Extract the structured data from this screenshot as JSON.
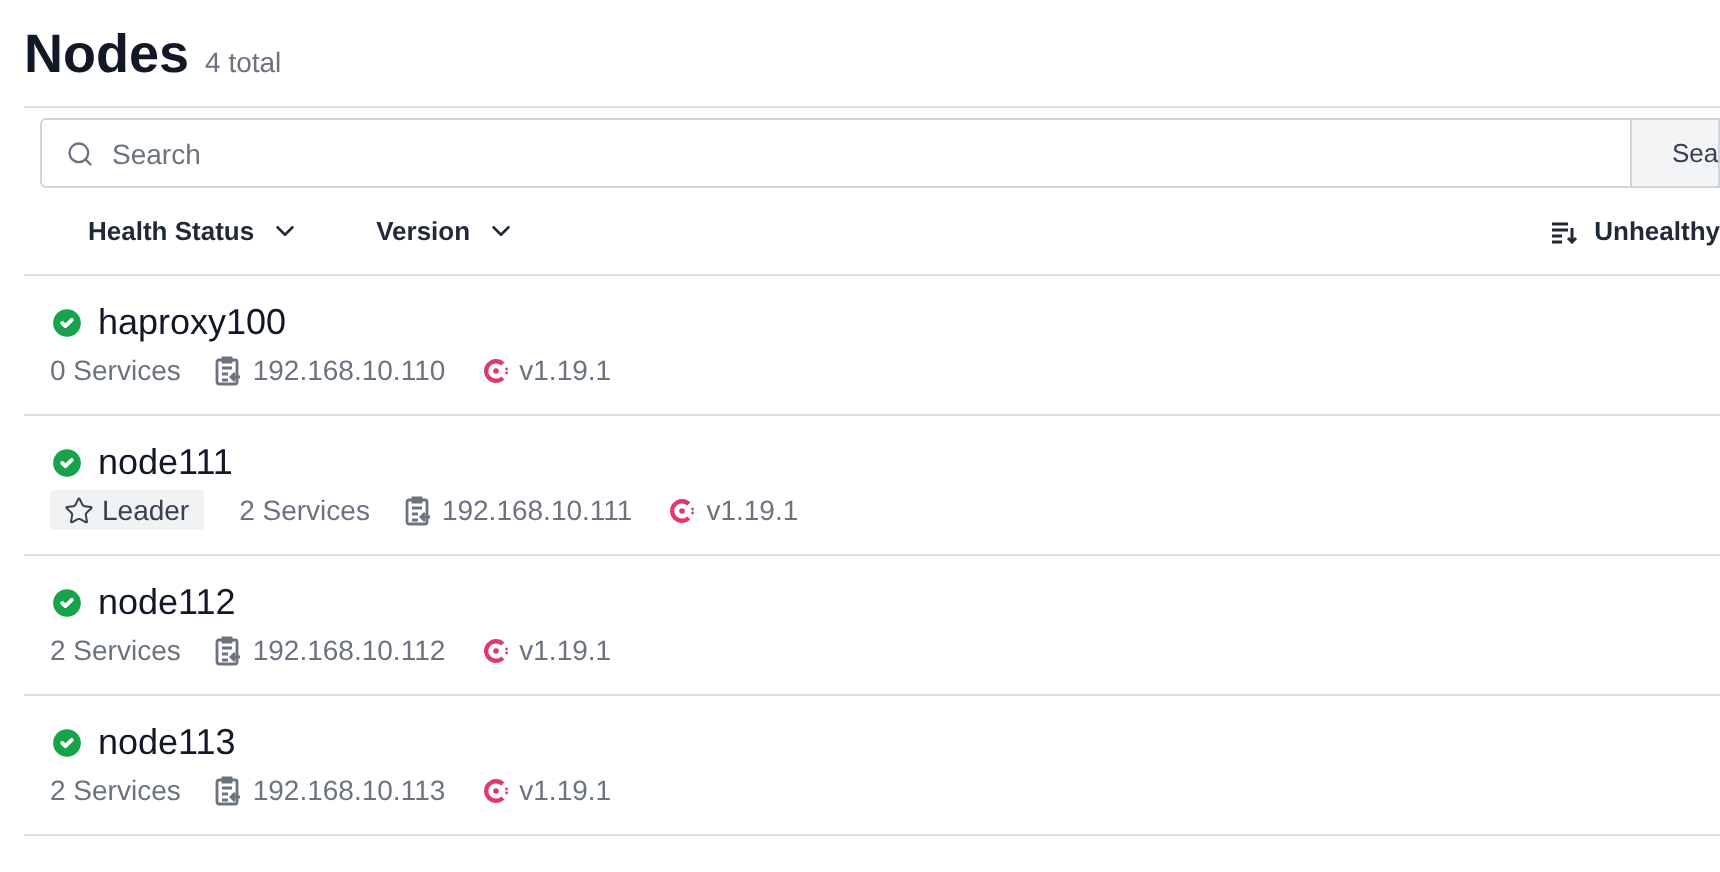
{
  "title": "Nodes",
  "count": "4 total",
  "search": {
    "placeholder": "Search",
    "button": "Sea"
  },
  "filters": [
    {
      "label": "Health Status"
    },
    {
      "label": "Version"
    }
  ],
  "sort": {
    "label": "Unhealthy"
  },
  "nodes": [
    {
      "name": "haproxy100",
      "healthy": true,
      "leader": false,
      "services": "0 Services",
      "address": "192.168.10.110",
      "version": "v1.19.1"
    },
    {
      "name": "node111",
      "healthy": true,
      "leader": true,
      "leader_label": "Leader",
      "services": "2 Services",
      "address": "192.168.10.111",
      "version": "v1.19.1"
    },
    {
      "name": "node112",
      "healthy": true,
      "leader": false,
      "services": "2 Services",
      "address": "192.168.10.112",
      "version": "v1.19.1"
    },
    {
      "name": "node113",
      "healthy": true,
      "leader": false,
      "services": "2 Services",
      "address": "192.168.10.113",
      "version": "v1.19.1"
    }
  ]
}
